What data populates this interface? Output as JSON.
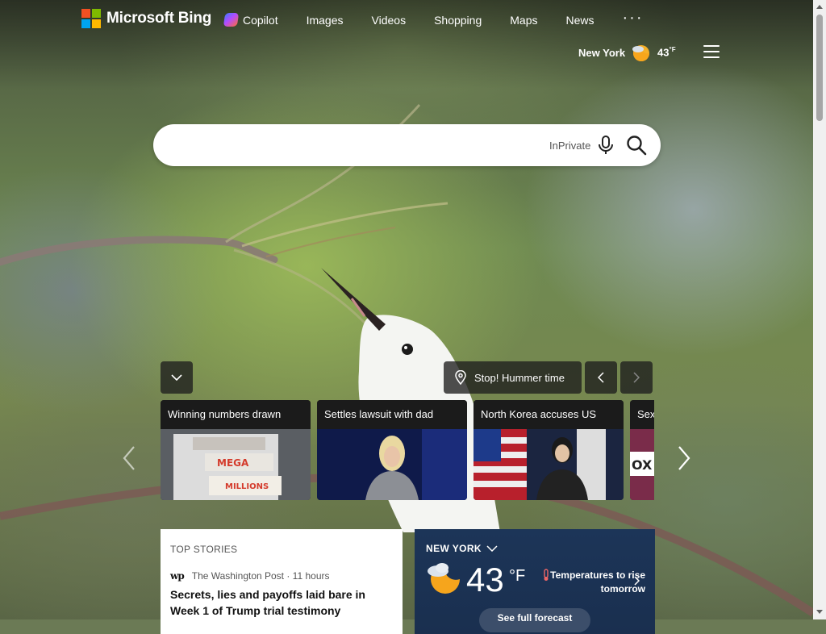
{
  "header": {
    "logo_text": "Microsoft Bing",
    "nav": [
      {
        "label": "Copilot",
        "icon": "copilot-icon"
      },
      {
        "label": "Images"
      },
      {
        "label": "Videos"
      },
      {
        "label": "Shopping"
      },
      {
        "label": "Maps"
      },
      {
        "label": "News"
      }
    ],
    "more": "···",
    "weather": {
      "city": "New York",
      "temp": "43",
      "unit": "°F",
      "icon": "moon-cloud-icon"
    },
    "menu_icon": "hamburger-icon"
  },
  "search": {
    "value": "",
    "inprivate_label": "InPrivate",
    "mic_icon": "microphone-icon",
    "search_icon": "search-icon"
  },
  "image_info": {
    "title": "Stop! Hummer time",
    "location_icon": "location-pin-icon"
  },
  "news_cards": [
    {
      "title": "Winning numbers drawn"
    },
    {
      "title": "Settles lawsuit with dad"
    },
    {
      "title": "North Korea accuses US"
    },
    {
      "title": "Sex"
    }
  ],
  "top_stories": {
    "label": "TOP STORIES",
    "source": "The Washington Post · 11 hours",
    "source_logo": "wp",
    "headline": "Secrets, lies and payoffs laid bare in Week 1 of Trump trial testimony"
  },
  "weather_card": {
    "city": "NEW YORK",
    "temp": "43",
    "unit": "°F",
    "note": "Temperatures to rise tomorrow",
    "forecast_label": "See full forecast"
  },
  "colors": {
    "ms_red": "#f25022",
    "ms_green": "#7fba00",
    "ms_blue": "#00a4ef",
    "ms_yellow": "#ffb900",
    "weather_card_bg": "#1c3558"
  }
}
